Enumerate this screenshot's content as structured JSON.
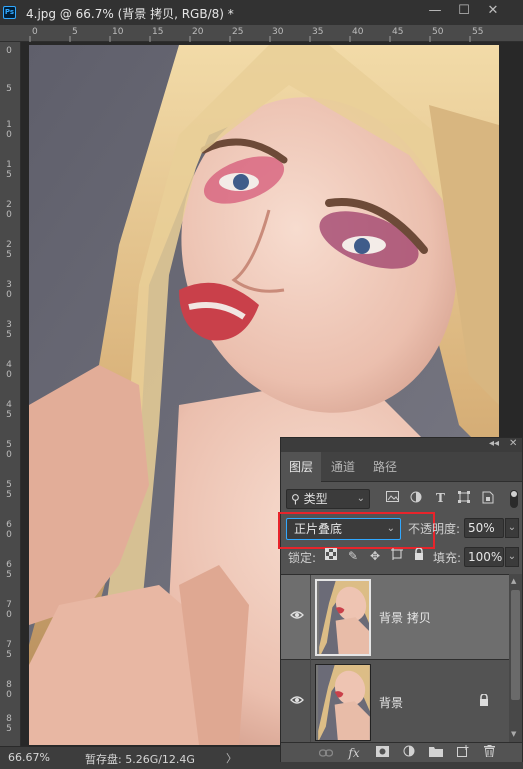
{
  "window": {
    "app_badge": "Ps",
    "title": "4.jpg @ 66.7% (背景 拷贝, RGB/8) *",
    "controls": {
      "minimize": "—",
      "maximize": "☐",
      "close": "✕"
    }
  },
  "rulers": {
    "top_ticks": [
      "0",
      "5",
      "10",
      "15",
      "20",
      "25",
      "30",
      "35",
      "40",
      "45",
      "50",
      "55"
    ],
    "left_ticks": [
      "0",
      "5",
      "1\n0",
      "1\n5",
      "2\n0",
      "2\n5",
      "3\n0",
      "3\n5",
      "4\n0",
      "4\n5",
      "5\n0",
      "5\n5",
      "6\n0",
      "6\n5",
      "7\n0",
      "7\n5",
      "8\n0",
      "8\n5"
    ]
  },
  "status": {
    "zoom": "66.67%",
    "scratch": "暂存盘: 5.26G/12.4G",
    "arrow": "〉"
  },
  "panel": {
    "header_collapse": "◂◂",
    "header_close": "✕",
    "tabs": [
      {
        "label": "图层",
        "active": true
      },
      {
        "label": "通道",
        "active": false
      },
      {
        "label": "路径",
        "active": false
      }
    ],
    "filter": {
      "search_glyph": "⚲",
      "kind_label": "类型",
      "chevron": "⌄",
      "icons": [
        "image-filter-icon",
        "adjustment-filter-icon",
        "type-filter-icon",
        "shape-filter-icon",
        "smart-object-filter-icon"
      ]
    },
    "blend": {
      "mode": "正片叠底",
      "chevron": "⌄",
      "opacity_label": "不透明度:",
      "opacity_value": "50%"
    },
    "lock": {
      "label": "锁定:",
      "fill_label": "填充:",
      "fill_value": "100%"
    },
    "layers": [
      {
        "name": "背景 拷贝",
        "selected": true,
        "visible": true,
        "locked": false
      },
      {
        "name": "背景",
        "selected": false,
        "visible": true,
        "locked": true
      }
    ],
    "bottom_icons": [
      "link-layers-icon",
      "fx-icon",
      "mask-icon",
      "adjustment-layer-icon",
      "group-folder-icon",
      "new-layer-icon",
      "trash-icon"
    ],
    "fx_label": "fx"
  },
  "colors": {
    "highlight_box": "#e8242b",
    "accent": "#31a8ff",
    "panel_bg": "#535353",
    "selected_layer": "#6e6e6e"
  }
}
